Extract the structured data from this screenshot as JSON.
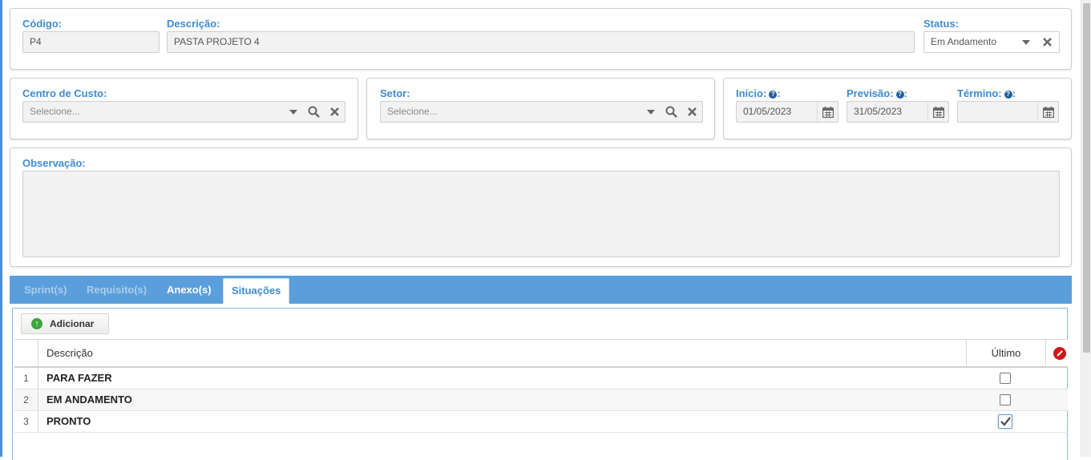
{
  "header": {
    "codigo": {
      "label": "Código:",
      "value": "P4"
    },
    "descricao": {
      "label": "Descrição:",
      "value": "PASTA PROJETO 4"
    },
    "status": {
      "label": "Status:",
      "value": "Em Andamento"
    }
  },
  "centro_custo": {
    "label": "Centro de Custo:",
    "placeholder": "Selecione..."
  },
  "setor": {
    "label": "Setor:",
    "placeholder": "Selecione..."
  },
  "datas": {
    "inicio": {
      "label": "Início:",
      "value": "01/05/2023"
    },
    "previsao": {
      "label": "Previsão:",
      "value": "31/05/2023"
    },
    "termino": {
      "label": "Término:",
      "value": ""
    }
  },
  "observacao": {
    "label": "Observação:",
    "value": ""
  },
  "tabs": [
    {
      "label": "Sprint(s)",
      "state": "disabled"
    },
    {
      "label": "Requisito(s)",
      "state": "disabled"
    },
    {
      "label": "Anexo(s)",
      "state": "normal"
    },
    {
      "label": "Situações",
      "state": "active"
    }
  ],
  "situacoes": {
    "add_label": "Adicionar",
    "columns": {
      "descricao": "Descrição",
      "ultimo": "Último"
    },
    "rows": [
      {
        "num": "1",
        "descricao": "PARA FAZER",
        "ultimo": false
      },
      {
        "num": "2",
        "descricao": "EM ANDAMENTO",
        "ultimo": false
      },
      {
        "num": "3",
        "descricao": "PRONTO",
        "ultimo": true
      }
    ]
  },
  "colors": {
    "accent": "#3f8bd0",
    "tabbar": "#5a9fdc"
  },
  "icons": [
    "chevron-down-icon",
    "search-icon",
    "close-icon",
    "calendar-icon",
    "help-icon",
    "add-icon",
    "clear-icon",
    "checkbox-icon"
  ]
}
